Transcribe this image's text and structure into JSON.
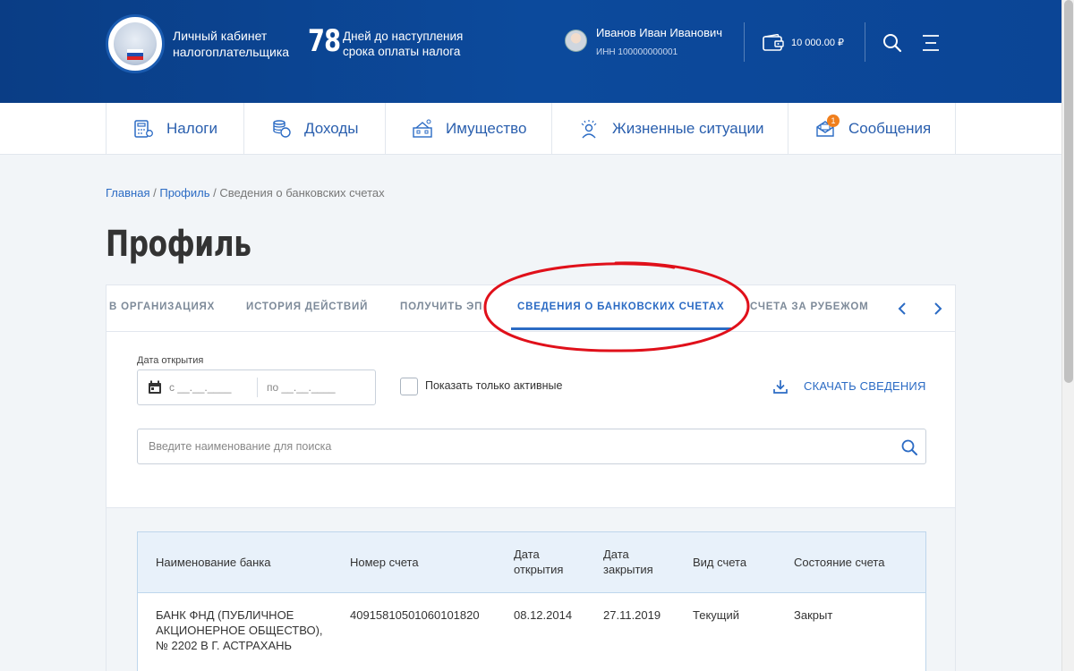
{
  "header": {
    "cabinet_title_line1": "Личный кабинет",
    "cabinet_title_line2": "налогоплательщика",
    "days_count": "78",
    "days_text_line1": "Дней до наступления",
    "days_text_line2": "срока оплаты налога",
    "user_name": "Иванов Иван Иванович",
    "user_inn": "ИНН 100000000001",
    "balance": "10 000.00 ₽"
  },
  "nav": {
    "items": [
      {
        "label": "Налоги",
        "icon": "calculator-icon"
      },
      {
        "label": "Доходы",
        "icon": "coins-icon"
      },
      {
        "label": "Имущество",
        "icon": "house-icon"
      },
      {
        "label": "Жизненные ситуации",
        "icon": "person-icon"
      },
      {
        "label": "Сообщения",
        "icon": "envelope-icon",
        "badge": "1"
      }
    ]
  },
  "breadcrumb": {
    "home": "Главная",
    "profile": "Профиль",
    "separator": "/",
    "current": "Сведения о банковских счетах"
  },
  "page": {
    "title": "Профиль"
  },
  "tabs": {
    "items": [
      "В ОРГАНИЗАЦИЯХ",
      "ИСТОРИЯ ДЕЙСТВИЙ",
      "ПОЛУЧИТЬ ЭП",
      "СВЕДЕНИЯ О БАНКОВСКИХ СЧЕТАХ",
      "СЧЕТА ЗА РУБЕЖОМ"
    ],
    "active": "СВЕДЕНИЯ О БАНКОВСКИХ СЧЕТАХ"
  },
  "filters": {
    "date_label": "Дата открытия",
    "date_from": "с __.__.____",
    "date_to": "по __.__.____",
    "active_only_label": "Показать только активные",
    "download_label": "СКАЧАТЬ СВЕДЕНИЯ",
    "search_placeholder": "Введите наименование для поиска"
  },
  "table": {
    "headers": {
      "bank": "Наименование банка",
      "account": "Номер счета",
      "open_date_1": "Дата",
      "open_date_2": "открытия",
      "close_date_1": "Дата",
      "close_date_2": "закрытия",
      "type": "Вид счета",
      "status": "Состояние счета"
    },
    "rows": [
      {
        "bank_line1": "БАНК ФНД (ПУБЛИЧНОЕ",
        "bank_line2": "АКЦИОНЕРНОЕ ОБЩЕСТВО),",
        "bank_line3": "№ 2202 В Г. АСТРАХАНЬ",
        "account": "40915810501060101820",
        "open_date": "08.12.2014",
        "close_date": "27.11.2019",
        "type": "Текущий",
        "status": "Закрыт"
      }
    ]
  },
  "colors": {
    "header_blue": "#0c4a9c",
    "link_blue": "#2b6bc4",
    "annotation_red": "#e0101a",
    "badge_orange": "#f07f1d"
  }
}
